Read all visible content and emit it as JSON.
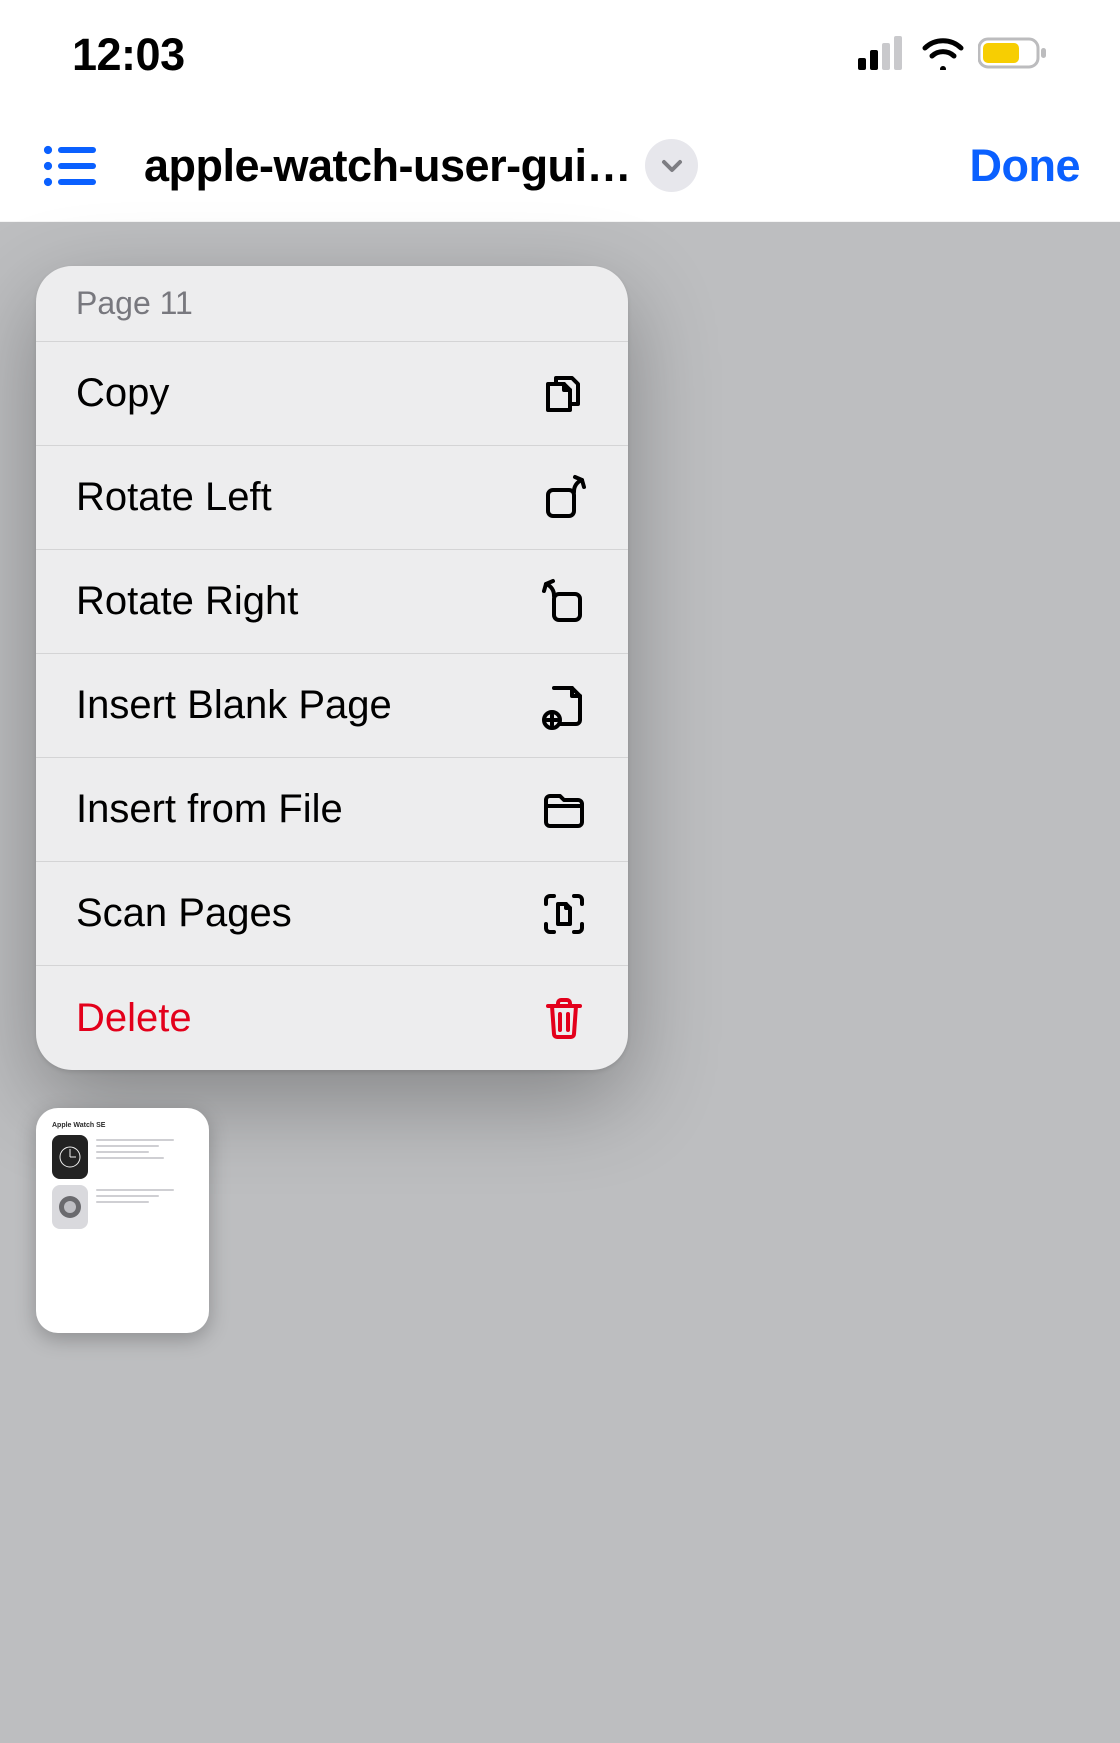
{
  "status_bar": {
    "time": "12:03"
  },
  "nav": {
    "title": "apple-watch-user-gui…",
    "done_label": "Done"
  },
  "menu": {
    "header": "Page 11",
    "copy": "Copy",
    "rotate_left": "Rotate Left",
    "rotate_right": "Rotate Right",
    "insert_blank": "Insert Blank Page",
    "insert_file": "Insert from File",
    "scan_pages": "Scan Pages",
    "delete": "Delete"
  },
  "thumbnail": {
    "page_title": "Apple Watch SE"
  }
}
